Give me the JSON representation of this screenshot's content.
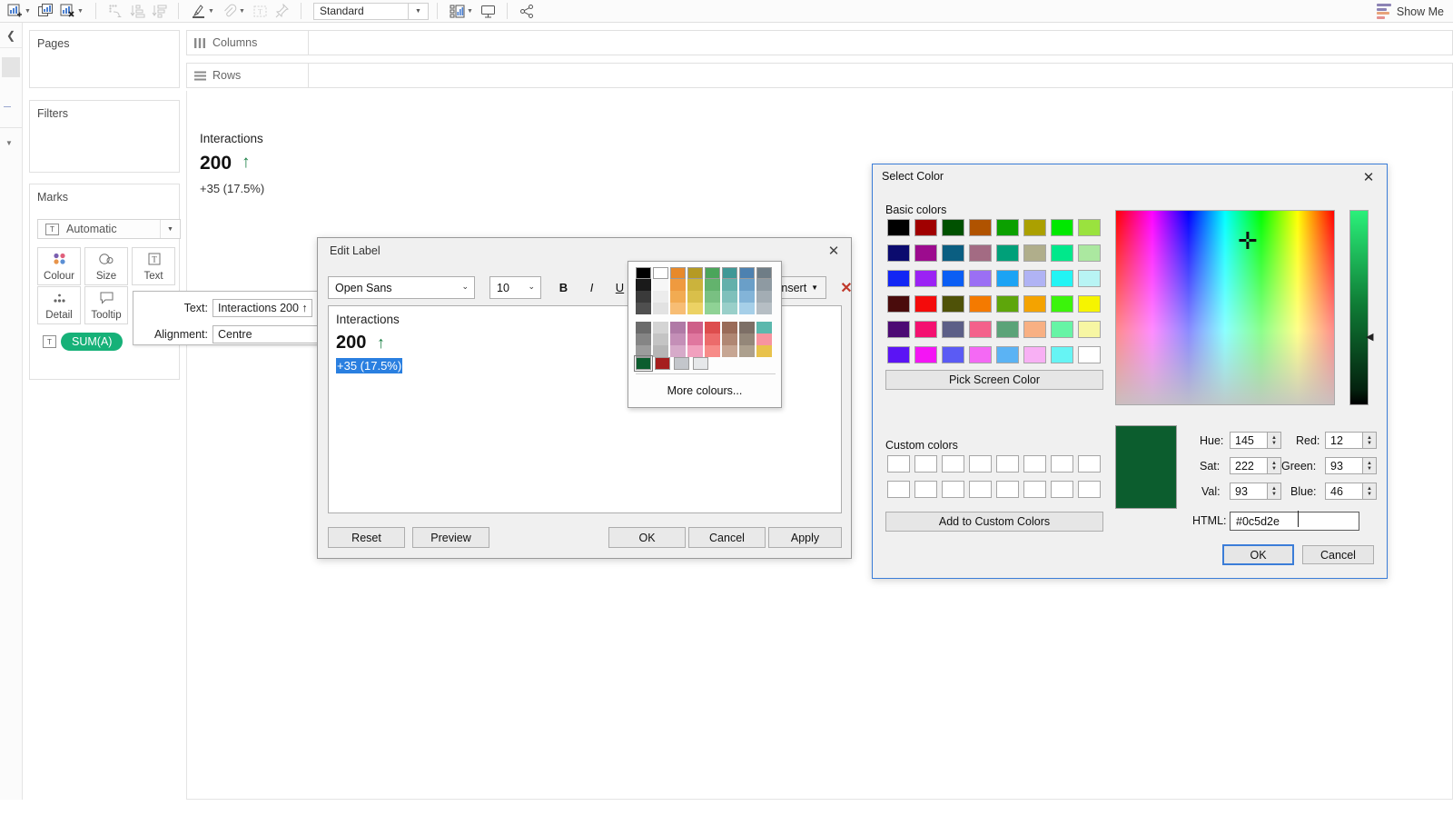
{
  "toolbar": {
    "buttons": [
      {
        "name": "new-worksheet-icon",
        "glyph": "bar-plus",
        "caret": true,
        "dim": false
      },
      {
        "name": "duplicate-sheet-icon",
        "glyph": "bar-dup",
        "caret": false,
        "dim": false
      },
      {
        "name": "clear-sheet-icon",
        "glyph": "bar-x",
        "caret": true,
        "dim": false
      },
      {
        "name": "swap-rows-columns-icon",
        "glyph": "swap",
        "caret": false,
        "dim": true
      },
      {
        "name": "sort-ascending-icon",
        "glyph": "sort-asc",
        "caret": false,
        "dim": true
      },
      {
        "name": "sort-descending-icon",
        "glyph": "sort-desc",
        "caret": false,
        "dim": true
      },
      {
        "name": "highlight-icon",
        "glyph": "pen",
        "caret": true,
        "dim": false
      },
      {
        "name": "annotate-icon",
        "glyph": "clip",
        "caret": true,
        "dim": false
      },
      {
        "name": "text-mark-icon",
        "glyph": "textbox",
        "caret": false,
        "dim": true
      },
      {
        "name": "fix-axis-icon",
        "glyph": "pin",
        "caret": false,
        "dim": true
      }
    ],
    "fit_value": "Standard",
    "right_buttons": [
      {
        "name": "show-hide-cards-icon",
        "glyph": "cards",
        "caret": true
      },
      {
        "name": "presentation-mode-icon",
        "glyph": "present",
        "caret": false
      },
      {
        "name": "share-icon",
        "glyph": "share",
        "caret": false
      }
    ],
    "show_me_label": "Show Me"
  },
  "shelves": {
    "columns_label": "Columns",
    "rows_label": "Rows"
  },
  "cards": {
    "pages_title": "Pages",
    "filters_title": "Filters",
    "marks_title": "Marks",
    "marks_type": "Automatic",
    "mark_buttons": [
      {
        "label": "Colour",
        "icon": "colour-dots-icon"
      },
      {
        "label": "Size",
        "icon": "size-circles-icon"
      },
      {
        "label": "Text",
        "icon": "text-box-icon"
      },
      {
        "label": "Detail",
        "icon": "detail-dots-icon"
      },
      {
        "label": "Tooltip",
        "icon": "tooltip-bubble-icon"
      }
    ],
    "pill_label": "SUM(A)",
    "pill_color": "#16b178"
  },
  "viz_label": {
    "title": "Interactions",
    "value": "200",
    "arrow": "↑",
    "delta": "+35 (17.5%)",
    "arrow_color": "#1a7f45"
  },
  "tooltip_panel": {
    "text_label": "Text:",
    "text_value": "Interactions 200 ↑",
    "alignment_label": "Alignment:",
    "alignment_value": "Centre"
  },
  "edit_label_dialog": {
    "title": "Edit Label",
    "close_glyph": "✕",
    "font_family_value": "Open Sans",
    "font_size_value": "10",
    "bold_label": "B",
    "italic_label": "I",
    "underline_label": "U",
    "current_color": "#0c5d2e",
    "align_left_glyph": "≡",
    "align_center_glyph": "≡",
    "align_right_glyph": "≡",
    "insert_label": "Insert",
    "clear_glyph": "✕",
    "preview": {
      "line1": "Interactions",
      "line2": "200",
      "arrow": "↑",
      "line3": "+35 (17.5%)",
      "selection_color": "#2a7fe0"
    },
    "buttons": {
      "reset": "Reset",
      "preview": "Preview",
      "ok": "OK",
      "cancel": "Cancel",
      "apply": "Apply"
    }
  },
  "color_palette_dropdown": {
    "more_colors_label": "More colours...",
    "rows": [
      [
        "#000000",
        "#ffffff",
        "#e8892a",
        "#b59a24",
        "#4ba55a",
        "#3f9896",
        "#4d81b0",
        "#6f7d86"
      ],
      [
        "#1a1a1a",
        "#f6f6f6",
        "#ef9a3f",
        "#cbb33c",
        "#63b36d",
        "#63b0ab",
        "#6a9fc8",
        "#8e9aa2"
      ],
      [
        "#3a3a3a",
        "#ececec",
        "#f2ab52",
        "#d9bf4a",
        "#79c082",
        "#7fc0bb",
        "#83b4d8",
        "#a3adb4"
      ],
      [
        "#4f4f4f",
        "#e2e2e2",
        "#f7bd74",
        "#ecd264",
        "#8fd295",
        "#99cfc9",
        "#a6cfe8",
        "#b6bec4"
      ],
      [
        "#6b6b6b",
        "#d4d4d4",
        "#b07aa6",
        "#ce5f89",
        "#dd4d4d",
        "#9a6b58",
        "#7d6f66",
        "#5bb8ad"
      ],
      [
        "#858585",
        "#c4c4c4",
        "#c48fb7",
        "#e0779f",
        "#ec6b6b",
        "#b08773",
        "#948779",
        "#f7949f"
      ],
      [
        "#9c9c9c",
        "#b6b6b6",
        "#d6aac9",
        "#f1a0be",
        "#f78b88",
        "#c7a693",
        "#ada08e",
        "#e8c24c"
      ]
    ],
    "recent": [
      "#0c5d2e",
      "#a51e1e",
      "#c3c6cb",
      "#e6e8ea"
    ],
    "selected_recent_index": 0
  },
  "select_color_dialog": {
    "title": "Select Color",
    "close_glyph": "✕",
    "basic_colors_label": "Basic colors",
    "basic_colors": [
      [
        "#000000",
        "#a00000",
        "#005100",
        "#b05300",
        "#0ba000",
        "#aba000",
        "#00e800",
        "#9ae23e"
      ],
      [
        "#0b0b6e",
        "#9c0b8e",
        "#0a5e81",
        "#a36b83",
        "#00a079",
        "#b0ae8b",
        "#00e88b",
        "#abe8a0"
      ],
      [
        "#1226f4",
        "#9b22f4",
        "#0b5ef4",
        "#9b6ff4",
        "#1ca3f4",
        "#b0b3f4",
        "#22f4f4",
        "#b8f4f4"
      ],
      [
        "#4a0c0c",
        "#f40b0b",
        "#4f5208",
        "#f47a00",
        "#5ea60b",
        "#f4a300",
        "#3bf40b",
        "#f6f400"
      ],
      [
        "#4c0a74",
        "#f41070",
        "#5c5f87",
        "#f4618b",
        "#5ba378",
        "#f8b083",
        "#66f4a5",
        "#f7f6a3"
      ],
      [
        "#5b14f4",
        "#f415f4",
        "#5b5bf4",
        "#f469f4",
        "#5bb3f4",
        "#f8b0f4",
        "#66f4f4",
        "#ffffff"
      ]
    ],
    "pick_screen_color_label": "Pick Screen Color",
    "custom_colors_label": "Custom colors",
    "custom_color_slots": 16,
    "add_to_custom_label": "Add to Custom Colors",
    "fields": {
      "hue_label": "Hue:",
      "hue_value": "145",
      "sat_label": "Sat:",
      "sat_value": "222",
      "val_label": "Val:",
      "val_value": "93",
      "red_label": "Red:",
      "red_value": "12",
      "green_label": "Green:",
      "green_value": "93",
      "blue_label": "Blue:",
      "blue_value": "46",
      "html_label": "HTML:",
      "html_value": "#0c5d2e"
    },
    "preview_color": "#0c5d2e",
    "ok_label": "OK",
    "cancel_label": "Cancel"
  }
}
